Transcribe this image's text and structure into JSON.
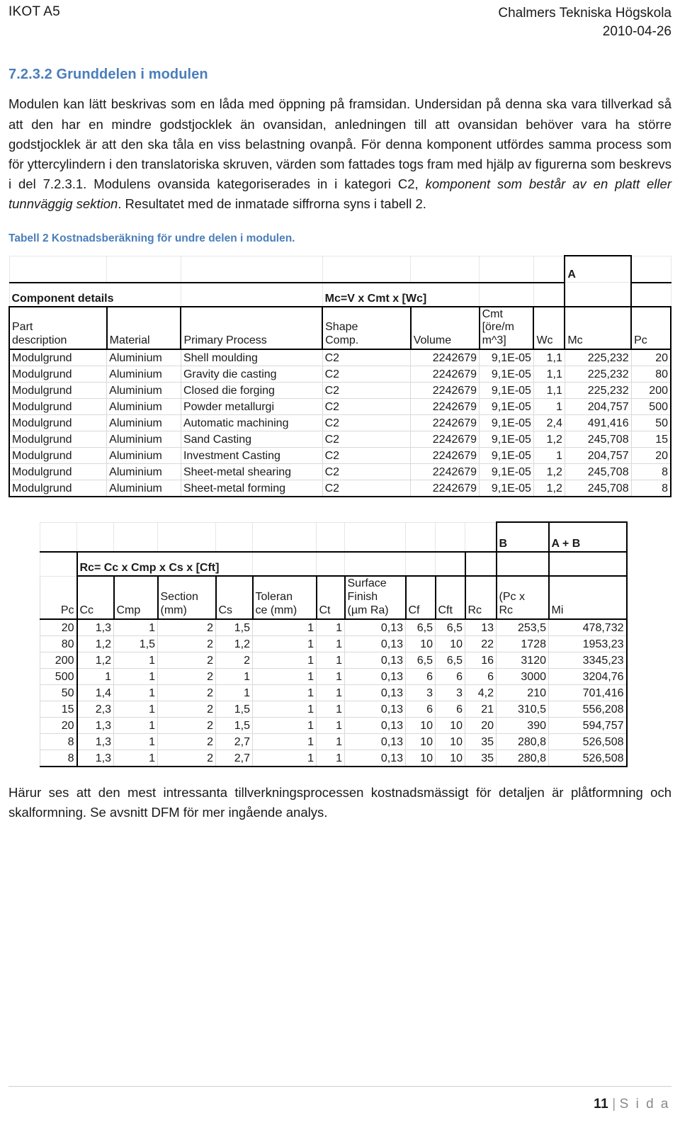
{
  "header": {
    "left": "IKOT A5",
    "org": "Chalmers Tekniska Högskola",
    "date": "2010-04-26"
  },
  "section": {
    "heading": "7.2.3.2 Grunddelen i modulen"
  },
  "paragraphs": {
    "intro_part1": "Modulen kan lätt beskrivas som en låda med öppning på framsidan. Undersidan på denna ska vara tillverkad så att den har en mindre godstjocklek än ovansidan, anledningen till att ovansidan behöver vara ha större godstjocklek är att den ska tåla en viss belastning ovanpå. För denna komponent utfördes samma process som för yttercylindern i den translatoriska skruven, värden som fattades togs fram med hjälp av figurerna som beskrevs i del 7.2.3.1.  Modulens ovansida kategoriserades in i kategori C2, ",
    "intro_italic": "komponent som består av en platt eller tunnväggig sektion",
    "intro_part2": ". Resultatet med de inmatade siffrorna syns i tabell 2.",
    "caption": "Tabell 2 Kostnadsberäkning för undre delen i modulen.",
    "closing": "Härur ses att den mest intressanta tillverkningsprocessen kostnadsmässigt för detaljen är plåtformning och skalformning. Se avsnitt DFM för mer ingående analys."
  },
  "table_one": {
    "group_labels": {
      "a": "A",
      "component_details": "Component details",
      "formula": "Mc=V x Cmt x [Wc]"
    },
    "columns": [
      "Part description",
      "Material",
      "Primary Process",
      "Shape Comp.",
      "Volume",
      "Cmt [öre/m m^3]",
      "Wc",
      "Mc",
      "Pc"
    ],
    "column_lines": {
      "part_1": "Part",
      "part_2": "description",
      "material": "Material",
      "primary_process": "Primary Process",
      "shape_1": "Shape",
      "shape_2": "Comp.",
      "volume": "Volume",
      "cmt_1": "Cmt",
      "cmt_2": "[öre/m",
      "cmt_3": "m^3]",
      "wc": "Wc",
      "mc": "Mc",
      "pc": "Pc"
    },
    "rows": [
      [
        "Modulgrund",
        "Aluminium",
        "Shell moulding",
        "C2",
        "2242679",
        "9,1E-05",
        "1,1",
        "225,232",
        "20"
      ],
      [
        "Modulgrund",
        "Aluminium",
        "Gravity die casting",
        "C2",
        "2242679",
        "9,1E-05",
        "1,1",
        "225,232",
        "80"
      ],
      [
        "Modulgrund",
        "Aluminium",
        "Closed die forging",
        "C2",
        "2242679",
        "9,1E-05",
        "1,1",
        "225,232",
        "200"
      ],
      [
        "Modulgrund",
        "Aluminium",
        "Powder metallurgi",
        "C2",
        "2242679",
        "9,1E-05",
        "1",
        "204,757",
        "500"
      ],
      [
        "Modulgrund",
        "Aluminium",
        "Automatic machining",
        "C2",
        "2242679",
        "9,1E-05",
        "2,4",
        "491,416",
        "50"
      ],
      [
        "Modulgrund",
        "Aluminium",
        "Sand Casting",
        "C2",
        "2242679",
        "9,1E-05",
        "1,2",
        "245,708",
        "15"
      ],
      [
        "Modulgrund",
        "Aluminium",
        "Investment Casting",
        "C2",
        "2242679",
        "9,1E-05",
        "1",
        "204,757",
        "20"
      ],
      [
        "Modulgrund",
        "Aluminium",
        "Sheet-metal shearing",
        "C2",
        "2242679",
        "9,1E-05",
        "1,2",
        "245,708",
        "8"
      ],
      [
        "Modulgrund",
        "Aluminium",
        "Sheet-metal forming",
        "C2",
        "2242679",
        "9,1E-05",
        "1,2",
        "245,708",
        "8"
      ]
    ]
  },
  "table_two": {
    "group_labels": {
      "b": "B",
      "a_plus_b": "A + B",
      "formula": "Rc= Cc x Cmp x Cs x [Cft]"
    },
    "columns": [
      "Pc",
      "Cc",
      "Cmp",
      "Section (mm)",
      "Cs",
      "Tolerance (mm)",
      "Ct",
      "Surface Finish (µm Ra)",
      "Cf",
      "Cft",
      "Rc",
      "(Pc x Rc",
      "Mi"
    ],
    "column_lines": {
      "pc": "Pc",
      "cc": "Cc",
      "cmp": "Cmp",
      "section_1": "Section",
      "section_2": "(mm)",
      "cs": "Cs",
      "toler_1": "Toleran",
      "toler_2": "ce (mm)",
      "ct": "Ct",
      "surface_1": "Surface",
      "surface_2": "Finish",
      "surface_3": "(µm Ra)",
      "cf": "Cf",
      "cft": "Cft",
      "rc": "Rc",
      "pcxrc_1": "(Pc x",
      "pcxrc_2": "Rc",
      "mi": "Mi"
    },
    "rows": [
      [
        "20",
        "1,3",
        "1",
        "2",
        "1,5",
        "1",
        "1",
        "0,13",
        "6,5",
        "6,5",
        "13",
        "253,5",
        "478,732"
      ],
      [
        "80",
        "1,2",
        "1,5",
        "2",
        "1,2",
        "1",
        "1",
        "0,13",
        "10",
        "10",
        "22",
        "1728",
        "1953,23"
      ],
      [
        "200",
        "1,2",
        "1",
        "2",
        "2",
        "1",
        "1",
        "0,13",
        "6,5",
        "6,5",
        "16",
        "3120",
        "3345,23"
      ],
      [
        "500",
        "1",
        "1",
        "2",
        "1",
        "1",
        "1",
        "0,13",
        "6",
        "6",
        "6",
        "3000",
        "3204,76"
      ],
      [
        "50",
        "1,4",
        "1",
        "2",
        "1",
        "1",
        "1",
        "0,13",
        "3",
        "3",
        "4,2",
        "210",
        "701,416"
      ],
      [
        "15",
        "2,3",
        "1",
        "2",
        "1,5",
        "1",
        "1",
        "0,13",
        "6",
        "6",
        "21",
        "310,5",
        "556,208"
      ],
      [
        "20",
        "1,3",
        "1",
        "2",
        "1,5",
        "1",
        "1",
        "0,13",
        "10",
        "10",
        "20",
        "390",
        "594,757"
      ],
      [
        "8",
        "1,3",
        "1",
        "2",
        "2,7",
        "1",
        "1",
        "0,13",
        "10",
        "10",
        "35",
        "280,8",
        "526,508"
      ],
      [
        "8",
        "1,3",
        "1",
        "2",
        "2,7",
        "1",
        "1",
        "0,13",
        "10",
        "10",
        "35",
        "280,8",
        "526,508"
      ]
    ]
  },
  "footer": {
    "page_number": "11",
    "separator": "|",
    "page_word": "S i d a"
  },
  "colors": {
    "heading_blue": "#4a7ebb",
    "text_black": "#1a1a1a",
    "grid_light": "#d9d9d9",
    "grid_dark": "#000000"
  }
}
